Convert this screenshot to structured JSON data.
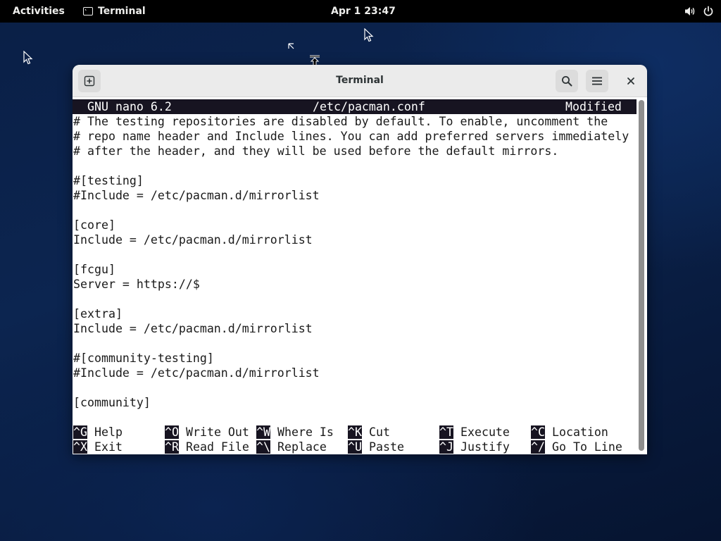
{
  "topbar": {
    "activities": "Activities",
    "app_name": "Terminal",
    "clock": "Apr 1  23:47",
    "icons": [
      "terminal-app-icon",
      "volume-icon",
      "power-icon"
    ]
  },
  "window": {
    "title": "Terminal",
    "buttons": [
      "new-tab-icon",
      "search-icon",
      "menu-icon",
      "close-icon"
    ]
  },
  "nano": {
    "version": "GNU nano 6.2",
    "filename": "/etc/pacman.conf",
    "status": "Modified",
    "lines": [
      "# The testing repositories are disabled by default. To enable, uncomment the",
      "# repo name header and Include lines. You can add preferred servers immediately",
      "# after the header, and they will be used before the default mirrors.",
      "",
      "#[testing]",
      "#Include = /etc/pacman.d/mirrorlist",
      "",
      "[core]",
      "Include = /etc/pacman.d/mirrorlist",
      "",
      "[fcgu]",
      "Server = https://$",
      "",
      "[extra]",
      "Include = /etc/pacman.d/mirrorlist",
      "",
      "#[community-testing]",
      "#Include = /etc/pacman.d/mirrorlist",
      "",
      "[community]"
    ],
    "shortcuts": [
      {
        "key": "^G",
        "label": "Help"
      },
      {
        "key": "^O",
        "label": "Write Out"
      },
      {
        "key": "^W",
        "label": "Where Is"
      },
      {
        "key": "^K",
        "label": "Cut"
      },
      {
        "key": "^T",
        "label": "Execute"
      },
      {
        "key": "^C",
        "label": "Location"
      },
      {
        "key": "^X",
        "label": "Exit"
      },
      {
        "key": "^R",
        "label": "Read File"
      },
      {
        "key": "^\\",
        "label": "Replace"
      },
      {
        "key": "^U",
        "label": "Paste"
      },
      {
        "key": "^J",
        "label": "Justify"
      },
      {
        "key": "^/",
        "label": "Go To Line"
      }
    ]
  }
}
